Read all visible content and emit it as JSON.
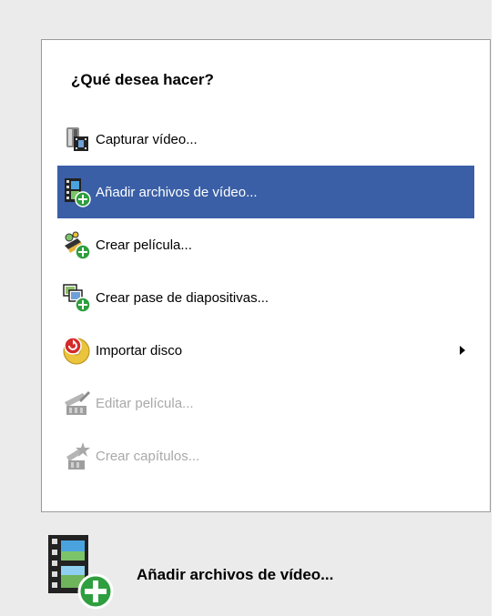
{
  "menu": {
    "heading": "¿Qué desea hacer?",
    "items": [
      {
        "label": "Capturar vídeo...",
        "icon": "capture-video-icon",
        "state": "normal"
      },
      {
        "label": "Añadir archivos de vídeo...",
        "icon": "add-video-files-icon",
        "state": "selected"
      },
      {
        "label": "Crear película...",
        "icon": "create-movie-icon",
        "state": "normal"
      },
      {
        "label": "Crear pase de diapositivas...",
        "icon": "create-slideshow-icon",
        "state": "normal"
      },
      {
        "label": "Importar disco",
        "icon": "import-disc-icon",
        "state": "normal",
        "submenu": true
      },
      {
        "label": "Editar película...",
        "icon": "edit-movie-icon",
        "state": "disabled"
      },
      {
        "label": "Crear capítulos...",
        "icon": "create-chapters-icon",
        "state": "disabled"
      }
    ]
  },
  "status": {
    "label": "Añadir archivos de vídeo...",
    "icon": "add-video-files-large-icon"
  },
  "colors": {
    "selection": "#3a5fa6",
    "panel_background": "#ebebeb",
    "disabled_text": "#a9a9a9"
  }
}
